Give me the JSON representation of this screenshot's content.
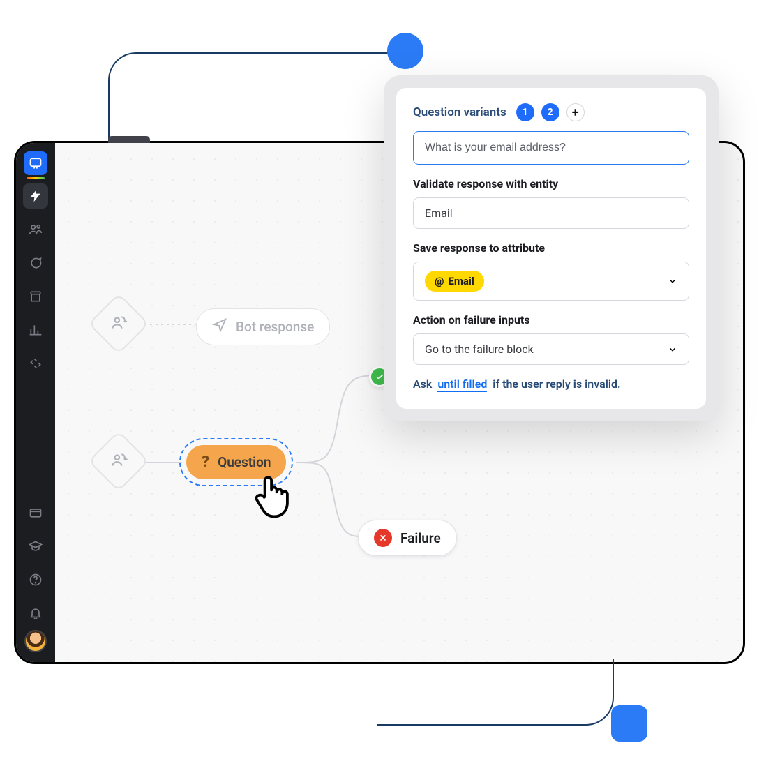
{
  "canvas": {
    "bot_response_label": "Bot response",
    "question_label": "Question",
    "failure_label": "Failure"
  },
  "panel": {
    "variants_label": "Question variants",
    "variant_numbers": [
      "1",
      "2"
    ],
    "question_text": "What is your email address?",
    "validate_label": "Validate response with entity",
    "validate_value": "Email",
    "save_label": "Save response to attribute",
    "attribute_chip": "Email",
    "failure_label": "Action on failure inputs",
    "failure_value": "Go to the failure block",
    "ask_prefix": "Ask",
    "ask_link": "until filled",
    "ask_suffix": "if the user reply is invalid."
  }
}
